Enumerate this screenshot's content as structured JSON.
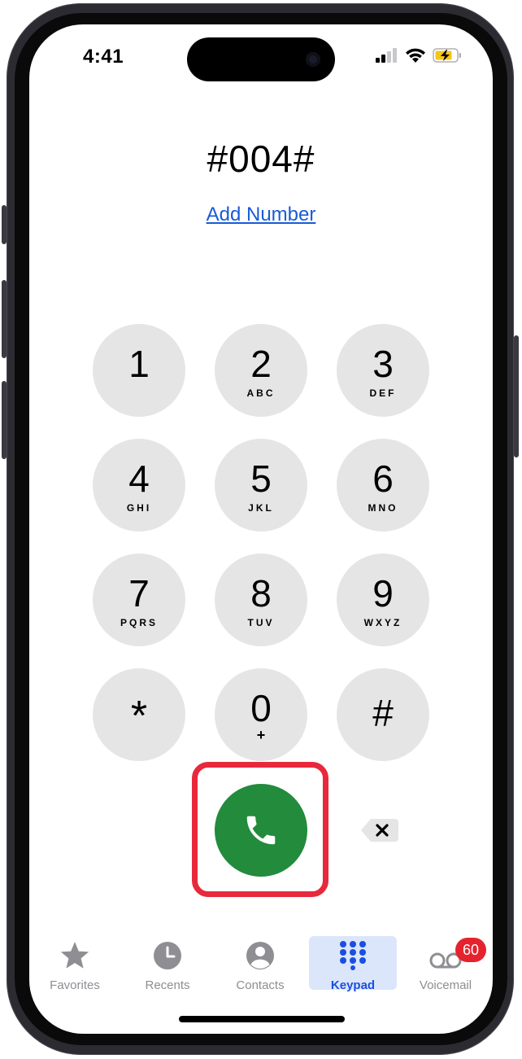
{
  "status": {
    "time": "4:41"
  },
  "dialer": {
    "number": "#004#",
    "add_number": "Add Number"
  },
  "keypad": [
    {
      "digit": "1",
      "letters": ""
    },
    {
      "digit": "2",
      "letters": "ABC"
    },
    {
      "digit": "3",
      "letters": "DEF"
    },
    {
      "digit": "4",
      "letters": "GHI"
    },
    {
      "digit": "5",
      "letters": "JKL"
    },
    {
      "digit": "6",
      "letters": "MNO"
    },
    {
      "digit": "7",
      "letters": "PQRS"
    },
    {
      "digit": "8",
      "letters": "TUV"
    },
    {
      "digit": "9",
      "letters": "WXYZ"
    },
    {
      "digit": "*",
      "letters": ""
    },
    {
      "digit": "0",
      "letters": "+"
    },
    {
      "digit": "#",
      "letters": ""
    }
  ],
  "tabs": [
    {
      "label": "Favorites",
      "icon": "star-icon"
    },
    {
      "label": "Recents",
      "icon": "clock-icon"
    },
    {
      "label": "Contacts",
      "icon": "person-circle-icon"
    },
    {
      "label": "Keypad",
      "icon": "keypad-grid-icon"
    },
    {
      "label": "Voicemail",
      "icon": "voicemail-icon"
    }
  ],
  "voicemail_badge": "60",
  "colors": {
    "accent": "#1a4fe0",
    "call_green": "#228b3c",
    "highlight_red": "#e8283c",
    "badge_red": "#e5232e"
  }
}
